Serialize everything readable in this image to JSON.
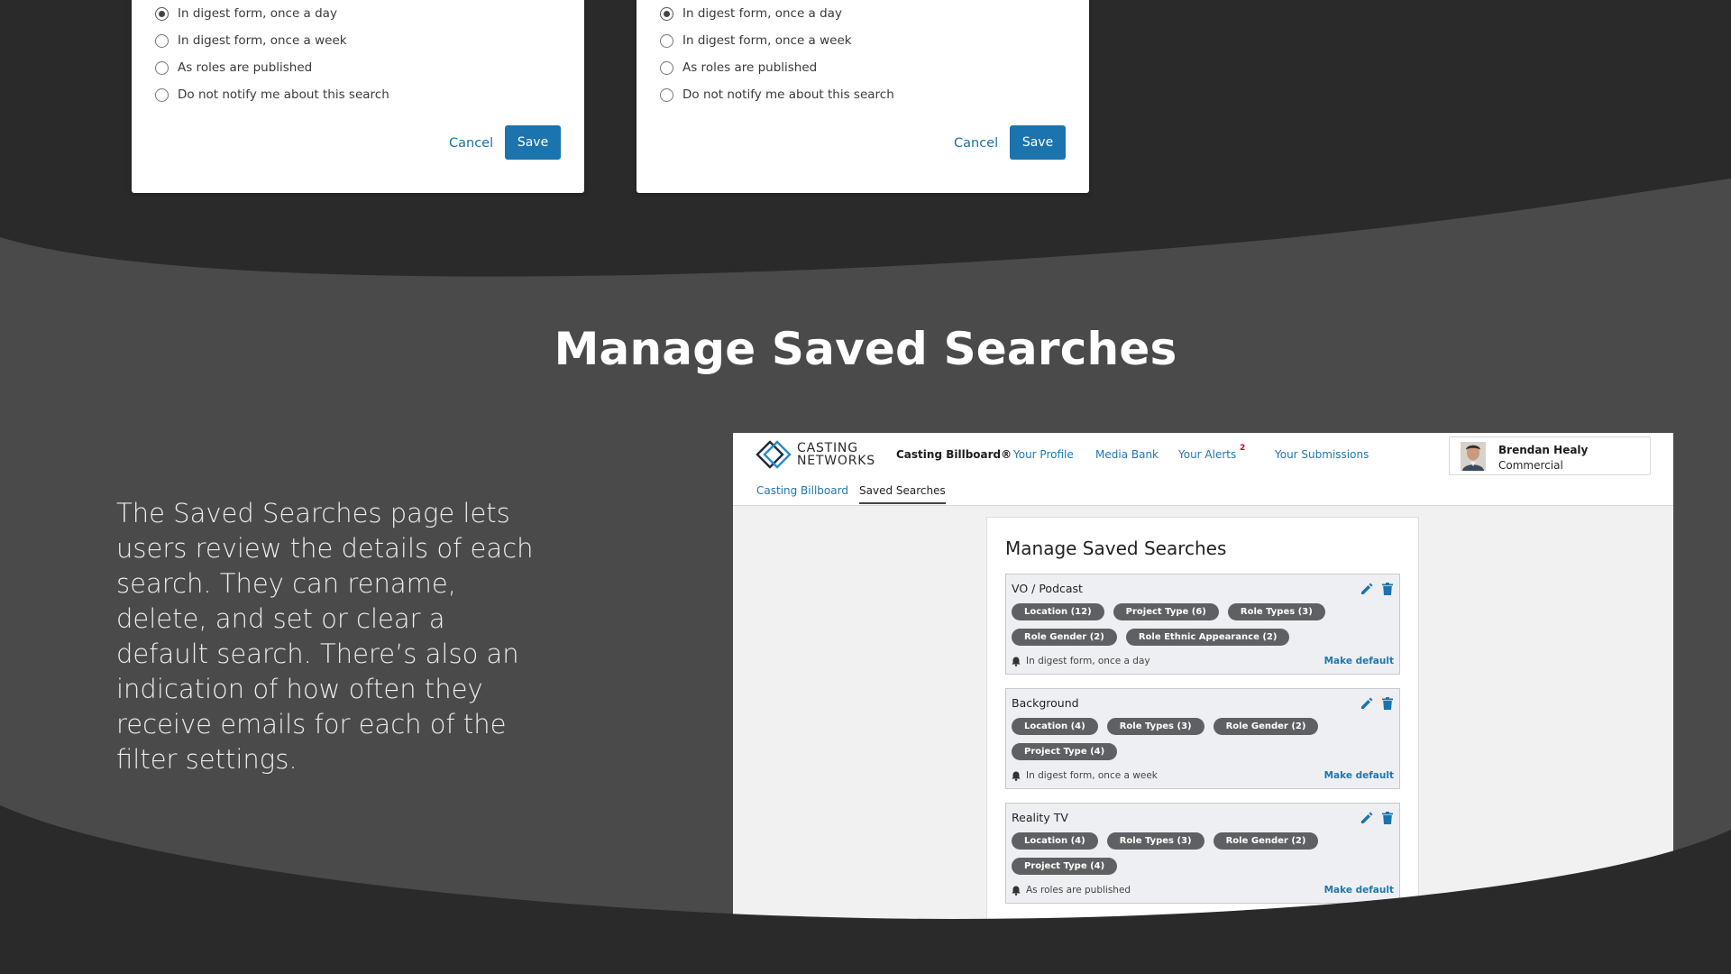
{
  "colors": {
    "page_bg": "#2a2a2b",
    "band_bg": "#4a4a4b",
    "accent": "#1b74ad",
    "tag_bg": "#5f6063",
    "alert_badge": "#d0021b"
  },
  "dialogs": [
    {
      "options": [
        {
          "label": "In digest form, once a day",
          "checked": true
        },
        {
          "label": "In digest form, once a week",
          "checked": false
        },
        {
          "label": "As roles are published",
          "checked": false
        },
        {
          "label": "Do not notify me about this search",
          "checked": false
        }
      ],
      "cancel_label": "Cancel",
      "save_label": "Save"
    },
    {
      "options": [
        {
          "label": "In digest form, once a day",
          "checked": true
        },
        {
          "label": "In digest form, once a week",
          "checked": false
        },
        {
          "label": "As roles are published",
          "checked": false
        },
        {
          "label": "Do not notify me about this search",
          "checked": false
        }
      ],
      "cancel_label": "Cancel",
      "save_label": "Save"
    }
  ],
  "section": {
    "title": "Manage Saved Searches",
    "description": "The Saved Searches page lets users review the details of each search. They can rename, delete, and set or clear a default search. There’s also an indication of how often they receive emails for each of the filter settings."
  },
  "app": {
    "logo": {
      "line1": "CASTING",
      "line2": "NETWORKS"
    },
    "nav": {
      "casting_billboard": "Casting Billboard®",
      "your_profile": "Your Profile",
      "media_bank": "Media Bank",
      "your_alerts": "Your Alerts",
      "alerts_count": "2",
      "your_submissions": "Your Submissions"
    },
    "user": {
      "name": "Brendan Healy",
      "role": "Commercial"
    },
    "subnav": {
      "link": "Casting Billboard",
      "current": "Saved Searches"
    },
    "panel_title": "Manage Saved Searches",
    "searches": [
      {
        "name": "VO / Podcast",
        "tags": [
          "Location (12)",
          "Project Type (6)",
          "Role Types (3)",
          "Role Gender (2)",
          "Role Ethnic Appearance (2)"
        ],
        "frequency": "In digest form, once a day",
        "make_default": "Make default"
      },
      {
        "name": "Background",
        "tags": [
          "Location (4)",
          "Role Types (3)",
          "Role Gender (2)",
          "Project Type (4)"
        ],
        "frequency": "In digest form, once a week",
        "make_default": "Make default"
      },
      {
        "name": "Reality TV",
        "tags": [
          "Location (4)",
          "Role Types (3)",
          "Role Gender (2)",
          "Project Type (4)"
        ],
        "frequency": "As roles are published",
        "make_default": "Make default"
      }
    ]
  }
}
